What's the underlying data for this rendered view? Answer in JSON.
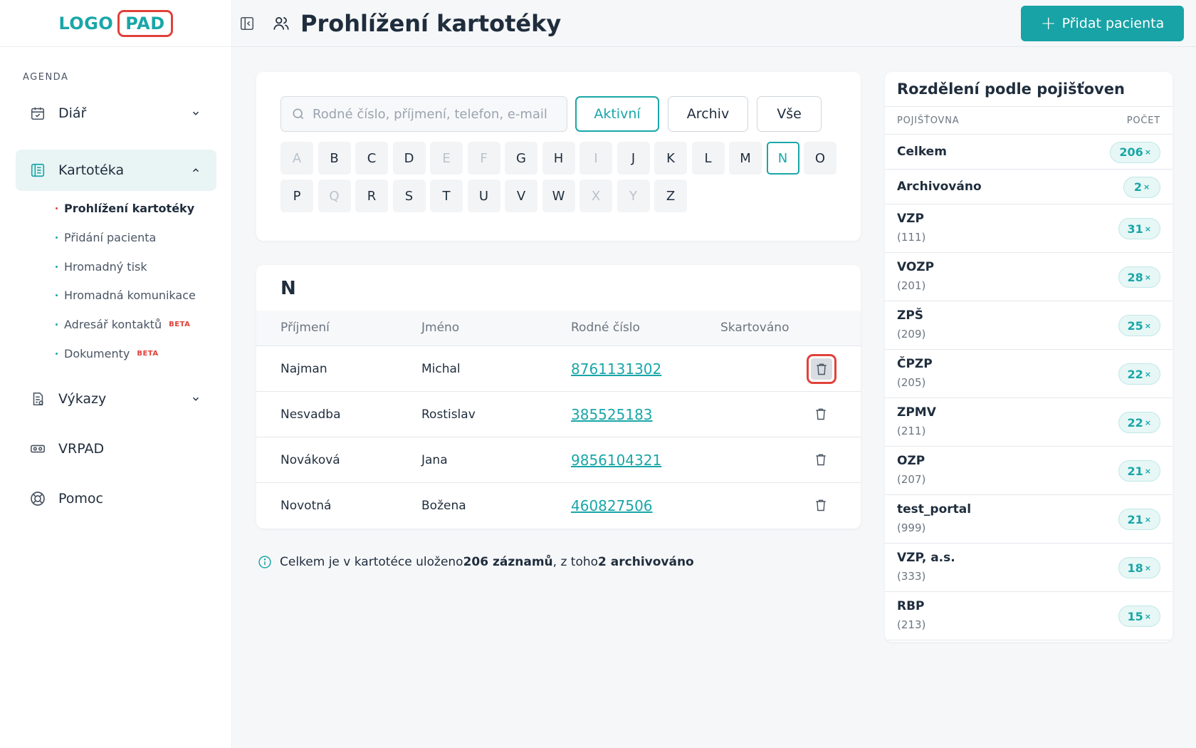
{
  "logo": {
    "left": "LOGO",
    "right": "PAD"
  },
  "sidebar": {
    "section_label": "AGENDA",
    "items": [
      {
        "label": "Diář"
      },
      {
        "label": "Kartotéka"
      },
      {
        "label": "Výkazy"
      },
      {
        "label": "VRPAD"
      },
      {
        "label": "Pomoc"
      }
    ],
    "sub_items": [
      {
        "label": "Prohlížení kartotéky",
        "badge": ""
      },
      {
        "label": "Přidání pacienta",
        "badge": ""
      },
      {
        "label": "Hromadný tisk",
        "badge": ""
      },
      {
        "label": "Hromadná komunikace",
        "badge": ""
      },
      {
        "label": "Adresář kontaktů",
        "badge": "BETA"
      },
      {
        "label": "Dokumenty",
        "badge": "BETA"
      }
    ]
  },
  "header": {
    "title": "Prohlížení kartotéky",
    "add_button": "Přidat pacienta",
    "add_button_plus": "+"
  },
  "search": {
    "placeholder": "Rodné číslo, příjmení, telefon, e-mail",
    "value": "",
    "filters": [
      "Aktivní",
      "Archiv",
      "Vše"
    ],
    "active_filter": "Aktivní"
  },
  "alphabet": {
    "row1": [
      "A",
      "B",
      "C",
      "D",
      "E",
      "F",
      "G",
      "H",
      "I",
      "J",
      "K",
      "L",
      "M",
      "N",
      "O"
    ],
    "row2": [
      "P",
      "Q",
      "R",
      "S",
      "T",
      "U",
      "V",
      "W",
      "X",
      "Y",
      "Z"
    ],
    "disabled": [
      "A",
      "E",
      "F",
      "I",
      "Q",
      "X",
      "Y"
    ],
    "active": "N"
  },
  "table": {
    "group_letter": "N",
    "columns": [
      "Příjmení",
      "Jméno",
      "Rodné číslo",
      "Skartováno"
    ],
    "rows": [
      {
        "surname": "Najman",
        "name": "Michal",
        "birth_number": "8761131302",
        "shredded": ""
      },
      {
        "surname": "Nesvadba",
        "name": "Rostislav",
        "birth_number": "385525183",
        "shredded": ""
      },
      {
        "surname": "Nováková",
        "name": "Jana",
        "birth_number": "9856104321",
        "shredded": ""
      },
      {
        "surname": "Novotná",
        "name": "Božena",
        "birth_number": "460827506",
        "shredded": ""
      }
    ]
  },
  "info": {
    "prefix": "Celkem je v kartotéce uloženo ",
    "count_text": "206 záznamů",
    "middle": ", z toho ",
    "archived_text": "2 archivováno"
  },
  "insurers": {
    "title": "Rozdělení podle pojišťoven",
    "col_name": "POJIŠŤOVNA",
    "col_count": "POČET",
    "rows": [
      {
        "name": "Celkem",
        "code": "",
        "count": "206"
      },
      {
        "name": "Archivováno",
        "code": "",
        "count": "2"
      },
      {
        "name": "VZP",
        "code": "(111)",
        "count": "31"
      },
      {
        "name": "VOZP",
        "code": "(201)",
        "count": "28"
      },
      {
        "name": "ZPŠ",
        "code": "(209)",
        "count": "25"
      },
      {
        "name": "ČPZP",
        "code": "(205)",
        "count": "22"
      },
      {
        "name": "ZPMV",
        "code": "(211)",
        "count": "22"
      },
      {
        "name": "OZP",
        "code": "(207)",
        "count": "21"
      },
      {
        "name": "test_portal",
        "code": "(999)",
        "count": "21"
      },
      {
        "name": "VZP, a.s.",
        "code": "(333)",
        "count": "18"
      },
      {
        "name": "RBP",
        "code": "(213)",
        "count": "15"
      }
    ],
    "times_mark": "×"
  },
  "colors": {
    "accent": "#1aa6a8",
    "highlight": "#e0413a"
  }
}
